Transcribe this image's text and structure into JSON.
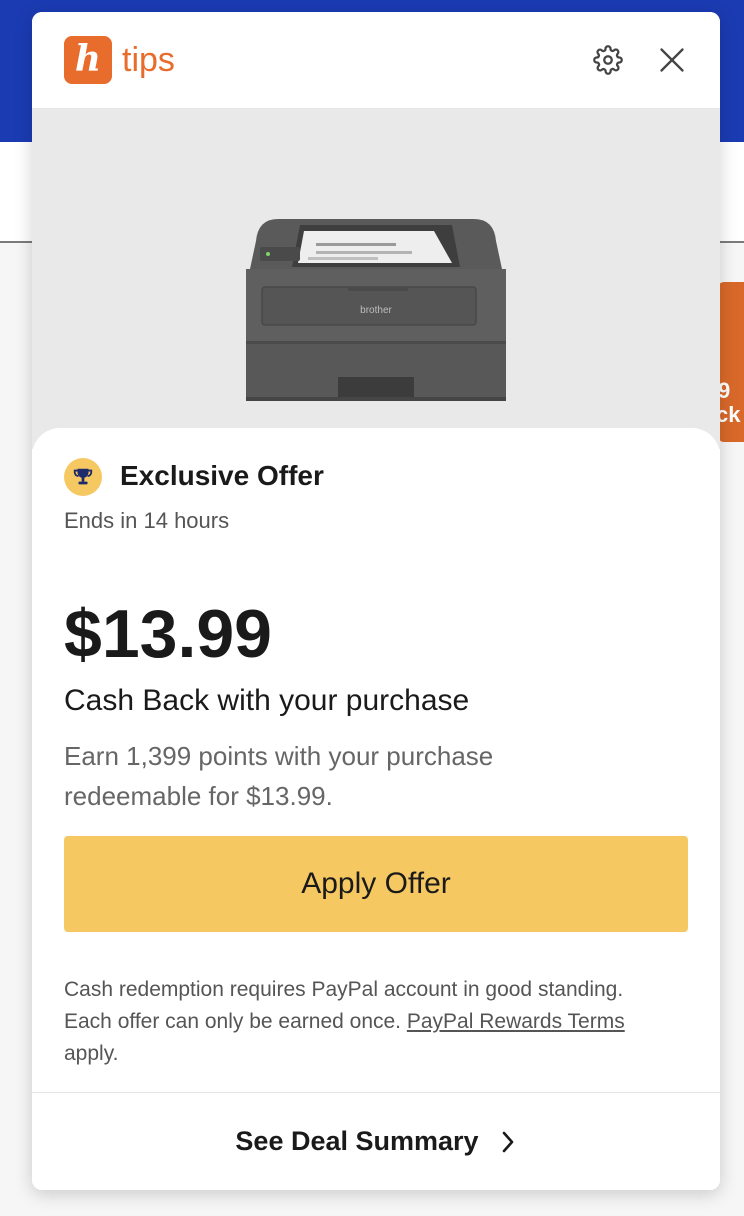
{
  "app": {
    "logo_letter": "h",
    "logo_text": "tips"
  },
  "header": {
    "settings_icon": "gear-icon",
    "close_icon": "close-icon"
  },
  "product": {
    "brand": "brother"
  },
  "background": {
    "side_tab_fragments": [
      "9",
      "ck"
    ]
  },
  "offer": {
    "badge_icon": "trophy-icon",
    "title": "Exclusive Offer",
    "expiry": "Ends in 14 hours",
    "price": "$13.99",
    "cashback_text": "Cash Back with your purchase",
    "points_text": "Earn 1,399 points with your purchase redeemable for $13.99.",
    "apply_button": "Apply Offer",
    "disclaimer_prefix": "Cash redemption requires PayPal account in good standing. Each offer can only be earned once. ",
    "terms_link": "PayPal Rewards Terms",
    "disclaimer_suffix": " apply.",
    "deal_summary": "See Deal Summary"
  },
  "colors": {
    "brand_orange": "#e86c2c",
    "button_yellow": "#f6c862",
    "page_blue": "#1b3bb3"
  }
}
